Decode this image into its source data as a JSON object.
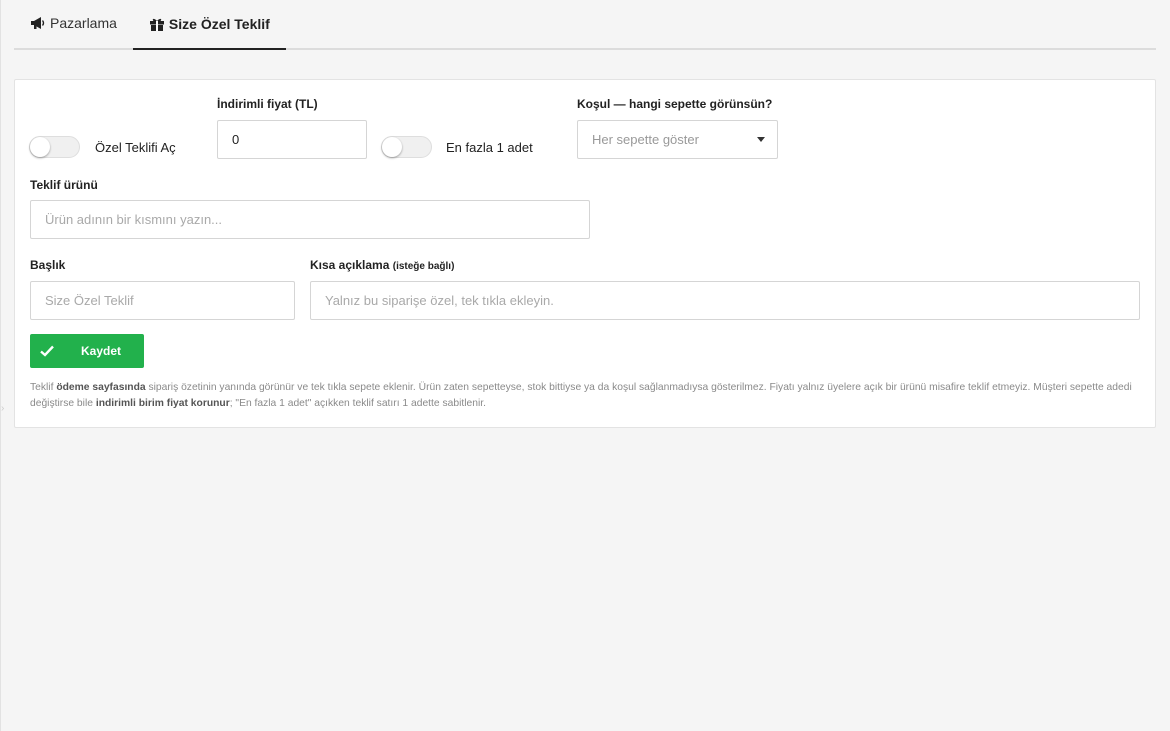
{
  "tabs": [
    {
      "label": "Pazarlama",
      "icon": "megaphone-icon",
      "active": false
    },
    {
      "label": "Size Özel Teklif",
      "icon": "gift-icon",
      "active": true
    }
  ],
  "form": {
    "offer_toggle": {
      "label": "Özel Teklifi Aç",
      "on": false
    },
    "price": {
      "label": "İndirimli fiyat (TL)",
      "value": "0"
    },
    "max_one_toggle": {
      "label": "En fazla 1 adet",
      "on": false
    },
    "condition": {
      "label": "Koşul — hangi sepette görünsün?",
      "selected": "Her sepette göster"
    },
    "product": {
      "label": "Teklif ürünü",
      "placeholder": "Ürün adının bir kısmını yazın..."
    },
    "title": {
      "label": "Başlık",
      "placeholder": "Size Özel Teklif"
    },
    "description": {
      "label": "Kısa açıklama",
      "label_note": "(isteğe bağlı)",
      "placeholder": "Yalnız bu siparişe özel, tek tıkla ekleyin."
    },
    "save_label": "Kaydet"
  },
  "help": {
    "p1_a": "Teklif ",
    "p1_b": "ödeme sayfasında",
    "p1_c": " sipariş özetinin yanında görünür ve tek tıkla sepete eklenir. Ürün zaten sepetteyse, stok bittiyse ya da koşul sağlanmadıysa gösterilmez. Fiyatı yalnız üyelere açık bir ürünü misafire teklif etmeyiz. Müşteri sepette adedi değiştirse bile ",
    "p1_d": "indirimli birim fiyat korunur",
    "p1_e": "; \"En fazla 1 adet\" açıkken teklif satırı 1 adette sabitlenir."
  },
  "colors": {
    "accent": "#22b14c",
    "background": "#f5f5f5",
    "panel": "#ffffff",
    "border": "#e3e3e3"
  }
}
